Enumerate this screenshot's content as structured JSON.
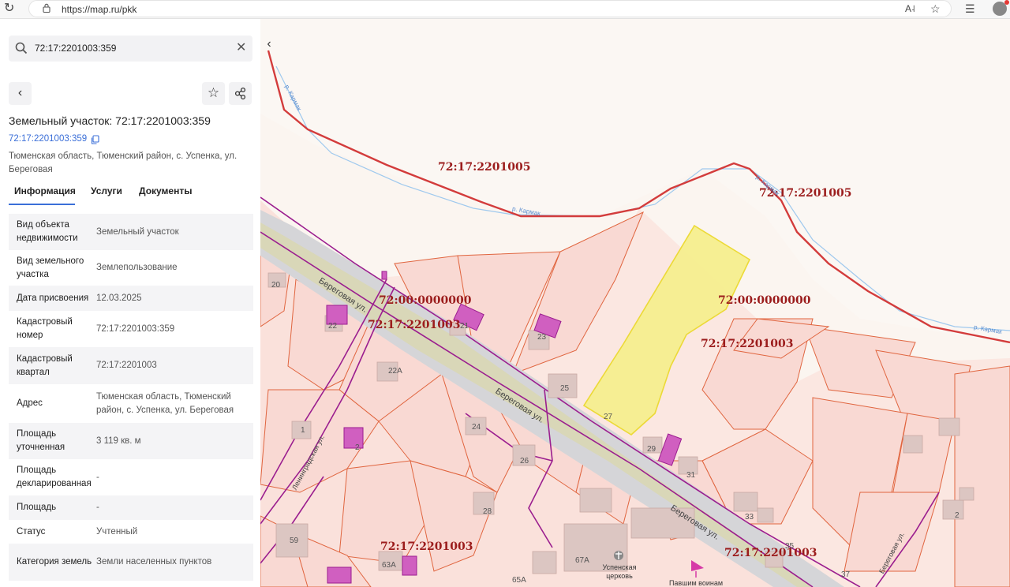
{
  "browser": {
    "url": "https://map.ru/pkk"
  },
  "search": {
    "value": "72:17:2201003:359"
  },
  "object": {
    "title": "Земельный участок: 72:17:2201003:359",
    "cad_number_link": "72:17:2201003:359",
    "address": "Тюменская область, Тюменский район, с. Успенка, ул. Береговая"
  },
  "tabs": [
    {
      "label": "Информация"
    },
    {
      "label": "Услуги"
    },
    {
      "label": "Документы"
    }
  ],
  "info_rows": [
    {
      "key": "Вид объекта недвижимости",
      "value": "Земельный участок"
    },
    {
      "key": "Вид земельного участка",
      "value": "Землепользование"
    },
    {
      "key": "Дата присвоения",
      "value": "12.03.2025"
    },
    {
      "key": "Кадастровый номер",
      "value": "72:17:2201003:359"
    },
    {
      "key": "Кадастровый квартал",
      "value": "72:17:2201003"
    },
    {
      "key": "Адрес",
      "value": "Тюменская область, Тюменский район, с. Успенка, ул. Береговая"
    },
    {
      "key": "Площадь уточненная",
      "value": "3 119 кв. м"
    },
    {
      "key": "Площадь декларированная",
      "value": "-"
    },
    {
      "key": "Площадь",
      "value": "-"
    },
    {
      "key": "Статус",
      "value": "Учтенный"
    },
    {
      "key": "Категория земель",
      "value": "Земли населенных пунктов"
    }
  ],
  "map": {
    "cad_labels": [
      "72:17:2201005",
      "72:17:2201005",
      "72:00:0000000",
      "72:00:0000000",
      "72:17:2201003",
      "72:17:2201003",
      "72:17:2201003",
      "72:17:2201003"
    ],
    "house_numbers": [
      "20",
      "22",
      "21",
      "23",
      "22А",
      "25",
      "27",
      "1",
      "2",
      "24",
      "26",
      "29",
      "31",
      "28",
      "59",
      "63А",
      "65А",
      "67А",
      "33",
      "35",
      "37",
      "2"
    ],
    "streets": [
      "Береговая ул.",
      "Береговая ул.",
      "Береговая ул.",
      "Ленинградская ул.",
      "Береговая ул."
    ],
    "rivers": [
      "р. Кармак",
      "р. Кармак",
      "р. Кармак",
      "р. Кармак"
    ],
    "pois": [
      "Успенская церковь",
      "Павшим воинам"
    ],
    "colors": {
      "quarter_border": "#d33c3c",
      "parcel_fill": "#f9d9d3",
      "parcel_border": "#e0653f",
      "selected_fill": "#f6ef8f",
      "selected_border": "#ecd92e",
      "building": "#d9b5b0",
      "utility": "#9b1e8f",
      "river": "#9fc9ee",
      "road": "#cfcfd1"
    }
  }
}
